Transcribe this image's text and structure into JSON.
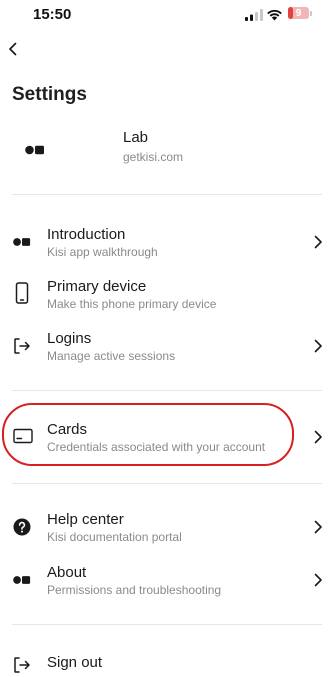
{
  "status_bar": {
    "time": "15:50",
    "battery_level": "9",
    "signal_icon": "cellular-signal-icon",
    "wifi_icon": "wifi-icon",
    "battery_icon": "battery-low-icon",
    "battery_color": "#e0443c"
  },
  "nav": {
    "back_icon": "chevron-left-icon"
  },
  "page": {
    "title": "Settings"
  },
  "account": {
    "name": "Lab",
    "domain": "getkisi.com",
    "logo_icon": "kisi-logo-icon"
  },
  "sections": [
    {
      "items": [
        {
          "title": "Introduction",
          "subtitle": "Kisi app walkthrough",
          "icon": "kisi-logo-icon",
          "has_chevron": true
        },
        {
          "title": "Primary device",
          "subtitle": "Make this phone primary device",
          "icon": "phone-icon",
          "has_chevron": false
        },
        {
          "title": "Logins",
          "subtitle": "Manage active sessions",
          "icon": "login-arrow-icon",
          "has_chevron": true
        }
      ]
    },
    {
      "items": [
        {
          "title": "Cards",
          "subtitle": "Credentials associated with your account",
          "icon": "card-icon",
          "has_chevron": true,
          "highlighted": true
        }
      ]
    },
    {
      "items": [
        {
          "title": "Help center",
          "subtitle": "Kisi documentation portal",
          "icon": "help-circle-icon",
          "has_chevron": true
        },
        {
          "title": "About",
          "subtitle": "Permissions and troubleshooting",
          "icon": "kisi-logo-icon",
          "has_chevron": true
        }
      ]
    }
  ],
  "sign_out": {
    "label": "Sign out",
    "icon": "sign-out-icon"
  },
  "colors": {
    "highlight": "#d7201f",
    "text_primary": "#1a1a1a",
    "text_secondary": "#8a8a8a",
    "divider": "#e6e6e6"
  }
}
